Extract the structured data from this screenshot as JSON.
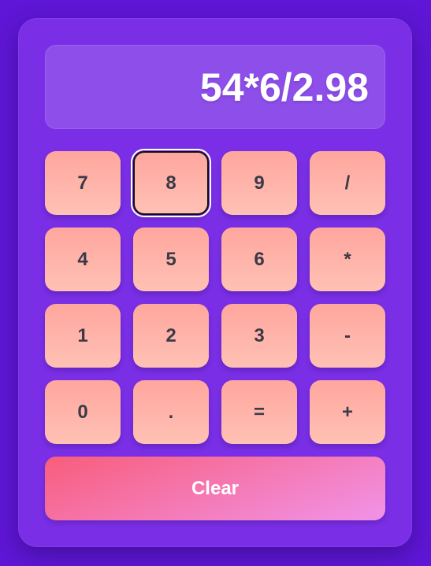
{
  "calculator": {
    "display": {
      "value": "54*6/2.98"
    },
    "keys": [
      {
        "label": "7",
        "focused": false
      },
      {
        "label": "8",
        "focused": true
      },
      {
        "label": "9",
        "focused": false
      },
      {
        "label": "/",
        "focused": false
      },
      {
        "label": "4",
        "focused": false
      },
      {
        "label": "5",
        "focused": false
      },
      {
        "label": "6",
        "focused": false
      },
      {
        "label": "*",
        "focused": false
      },
      {
        "label": "1",
        "focused": false
      },
      {
        "label": "2",
        "focused": false
      },
      {
        "label": "3",
        "focused": false
      },
      {
        "label": "-",
        "focused": false
      },
      {
        "label": "0",
        "focused": false
      },
      {
        "label": ".",
        "focused": false
      },
      {
        "label": "=",
        "focused": false
      },
      {
        "label": "+",
        "focused": false
      }
    ],
    "clear_label": "Clear"
  },
  "colors": {
    "background": "#5f16d6",
    "panel": "#7a2fe6",
    "key_gradient_start": "#ffa69e",
    "key_gradient_end": "#ffc1b5",
    "key_text": "#3a3a48",
    "clear_gradient_start": "#f85d7b",
    "clear_gradient_end": "#f193e8"
  }
}
